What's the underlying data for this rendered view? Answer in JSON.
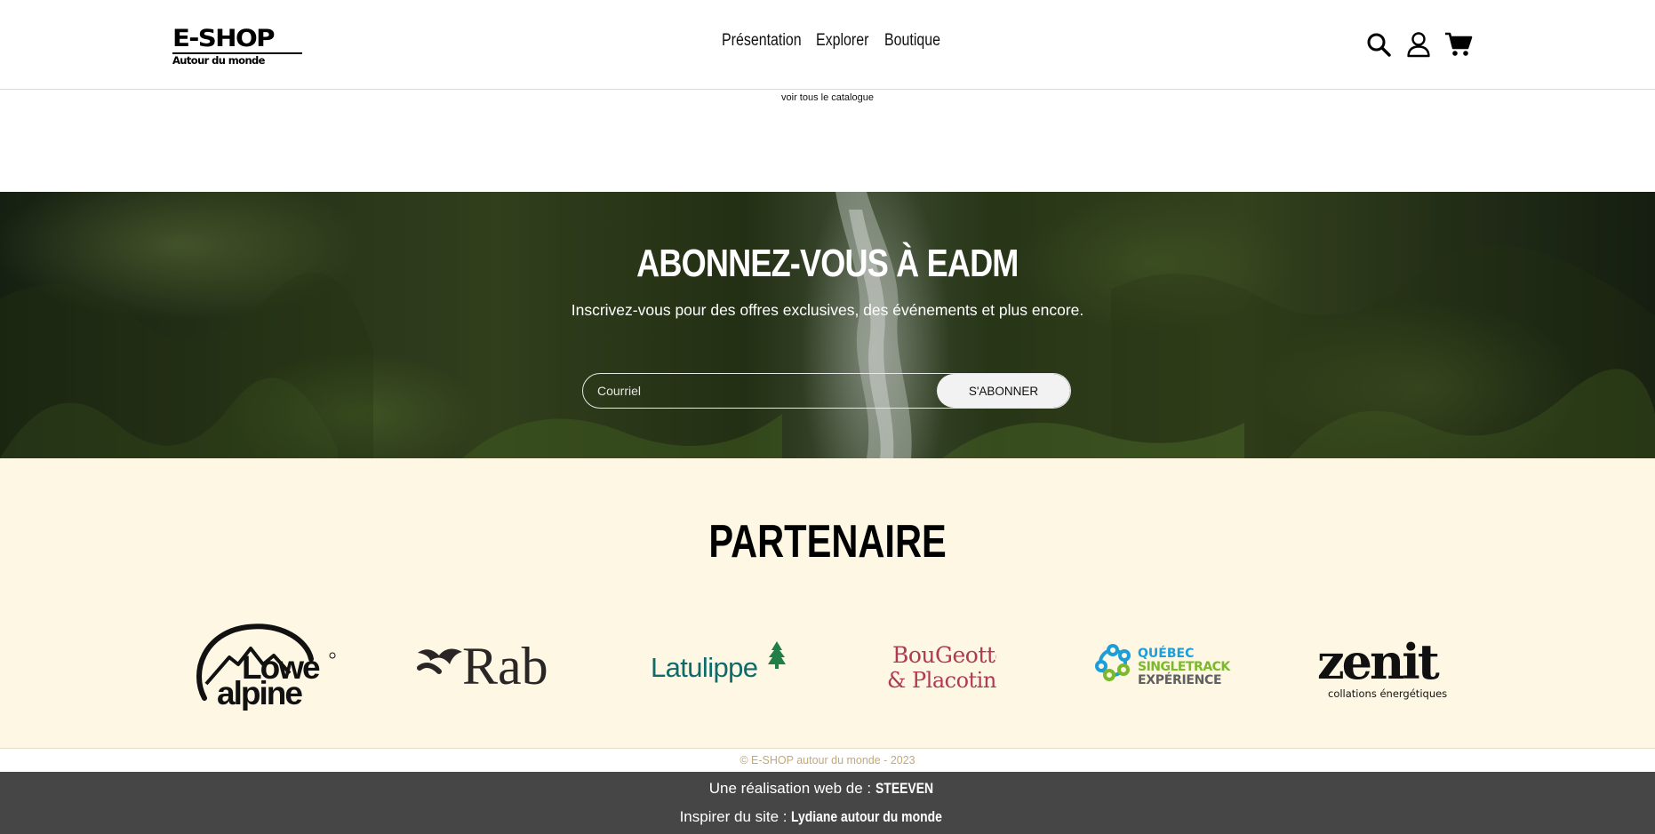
{
  "header": {
    "logo_main": "E-SHOP",
    "logo_sub": "Autour du monde",
    "nav": [
      {
        "label": "Présentation"
      },
      {
        "label": "Explorer"
      },
      {
        "label": "Boutique"
      }
    ],
    "icons": [
      "search-icon",
      "user-icon",
      "cart-icon"
    ]
  },
  "catalog_link": "voir tous le catalogue",
  "newsletter": {
    "title": "ABONNEZ-VOUS À EADM",
    "subtitle": "Inscrivez-vous pour des offres exclusives, des événements et plus encore.",
    "email_placeholder": "Courriel",
    "email_value": "",
    "subscribe_label": "S'ABONNER"
  },
  "partners": {
    "title": "PARTENAIRE",
    "logos": [
      {
        "name": "Lowe alpine",
        "line1": "Lowe",
        "line2": "alpine",
        "color": "#111111"
      },
      {
        "name": "Rab",
        "text": "Rab",
        "color": "#2a2626"
      },
      {
        "name": "Latulippe",
        "text": "Latulippe",
        "color": "#0f6a6a"
      },
      {
        "name": "Bougeotte & Placotine",
        "line1": "BouGeotte",
        "line2": "& Placotine",
        "color": "#b03a53"
      },
      {
        "name": "Québec Singletrack Expérience",
        "line1": "QUÉBEC",
        "line2": "SINGLETRACK",
        "line3": "EXPÉRIENCE"
      },
      {
        "name": "Zenit",
        "text": "zenit",
        "tagline": "collations énergétiques",
        "color": "#111111"
      }
    ]
  },
  "footer": {
    "copyright": "© E-SHOP autour du monde - 2023",
    "credit_prefix": "Une réalisation web de :",
    "credit_name": "STEEVEN",
    "inspired_prefix": "Inspirer du site :",
    "inspired_name": "Lydiane autour du monde"
  }
}
